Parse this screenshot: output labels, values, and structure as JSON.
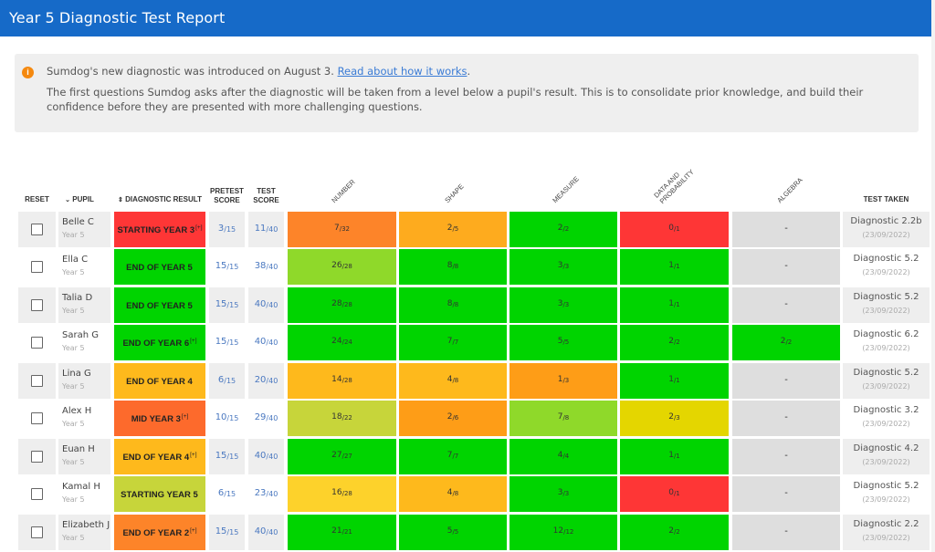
{
  "header": {
    "title": "Year 5 Diagnostic Test Report"
  },
  "notice": {
    "icon": "info-icon",
    "text_before_link": "Sumdog's new diagnostic was introduced on August 3. ",
    "link_text": "Read about how it works",
    "text_after_link": ".",
    "detail": "The first questions Sumdog asks after the diagnostic will be taken from a level below a pupil's result. This is to consolidate prior knowledge, and build their confidence before they are presented with more challenging questions."
  },
  "colors": {
    "header_blue": "#166ac8",
    "red": "#fe3636",
    "orange_red": "#fd6a2c",
    "orange": "#fd8429",
    "dark_orange": "#fe9d17",
    "amber": "#feb91c",
    "yellow": "#fdd22b",
    "olive_yellow": "#e4d600",
    "yellow_green": "#c7d53a",
    "light_green": "#8fd92a",
    "green": "#00d400",
    "grey": "#dedede"
  },
  "table": {
    "headers": {
      "reset": "RESET",
      "pupil": "PUPIL",
      "pupil_sort_icon": "chevron-down-icon",
      "diagnostic": "DIAGNOSTIC RESULT",
      "diagnostic_sort_icon": "sort-icon",
      "pretest_1": "PRETEST",
      "pretest_2": "SCORE",
      "test_1": "TEST",
      "test_2": "SCORE",
      "number": "NUMBER",
      "shape": "SHAPE",
      "measure": "MEASURE",
      "data_1": "DATA AND",
      "data_2": "PROBABILITY",
      "algebra": "ALGEBRA",
      "taken": "TEST TAKEN"
    },
    "rows": [
      {
        "name": "Belle C",
        "year": "Year 5",
        "result": "STARTING YEAR 3",
        "plus": "[+]",
        "result_color": "#fe3636",
        "pre": "3",
        "pre_total": "/15",
        "test": "11",
        "test_total": "/40",
        "number": "7",
        "number_total": "/32",
        "number_color": "#fd8429",
        "shape": "2",
        "shape_total": "/5",
        "shape_color": "#feab1e",
        "measure": "2",
        "measure_total": "/2",
        "measure_color": "#00d400",
        "data": "0",
        "data_total": "/1",
        "data_color": "#fe3636",
        "algebra": "-",
        "algebra_total": "",
        "algebra_color": "#dedede",
        "taken": "Diagnostic 2.2b",
        "date": "(23/09/2022)"
      },
      {
        "name": "Ella C",
        "year": "Year 5",
        "result": "END OF YEAR 5",
        "plus": "",
        "result_color": "#00d400",
        "pre": "15",
        "pre_total": "/15",
        "test": "38",
        "test_total": "/40",
        "number": "26",
        "number_total": "/28",
        "number_color": "#8fd92a",
        "shape": "8",
        "shape_total": "/8",
        "shape_color": "#00d400",
        "measure": "3",
        "measure_total": "/3",
        "measure_color": "#00d400",
        "data": "1",
        "data_total": "/1",
        "data_color": "#00d400",
        "algebra": "-",
        "algebra_total": "",
        "algebra_color": "#dedede",
        "taken": "Diagnostic 5.2",
        "date": "(23/09/2022)"
      },
      {
        "name": "Talia D",
        "year": "Year 5",
        "result": "END OF YEAR 5",
        "plus": "",
        "result_color": "#00d400",
        "pre": "15",
        "pre_total": "/15",
        "test": "40",
        "test_total": "/40",
        "number": "28",
        "number_total": "/28",
        "number_color": "#00d400",
        "shape": "8",
        "shape_total": "/8",
        "shape_color": "#00d400",
        "measure": "3",
        "measure_total": "/3",
        "measure_color": "#00d400",
        "data": "1",
        "data_total": "/1",
        "data_color": "#00d400",
        "algebra": "-",
        "algebra_total": "",
        "algebra_color": "#dedede",
        "taken": "Diagnostic 5.2",
        "date": "(23/09/2022)"
      },
      {
        "name": "Sarah G",
        "year": "Year 5",
        "result": "END OF YEAR 6",
        "plus": "[+]",
        "result_color": "#00d400",
        "pre": "15",
        "pre_total": "/15",
        "test": "40",
        "test_total": "/40",
        "number": "24",
        "number_total": "/24",
        "number_color": "#00d400",
        "shape": "7",
        "shape_total": "/7",
        "shape_color": "#00d400",
        "measure": "5",
        "measure_total": "/5",
        "measure_color": "#00d400",
        "data": "2",
        "data_total": "/2",
        "data_color": "#00d400",
        "algebra": "2",
        "algebra_total": "/2",
        "algebra_color": "#00d400",
        "taken": "Diagnostic 6.2",
        "date": "(23/09/2022)"
      },
      {
        "name": "Lina G",
        "year": "Year 5",
        "result": "END OF YEAR 4",
        "plus": "",
        "result_color": "#feb91c",
        "pre": "6",
        "pre_total": "/15",
        "test": "20",
        "test_total": "/40",
        "number": "14",
        "number_total": "/28",
        "number_color": "#feb91c",
        "shape": "4",
        "shape_total": "/8",
        "shape_color": "#feb91c",
        "measure": "1",
        "measure_total": "/3",
        "measure_color": "#fe9d17",
        "data": "1",
        "data_total": "/1",
        "data_color": "#00d400",
        "algebra": "-",
        "algebra_total": "",
        "algebra_color": "#dedede",
        "taken": "Diagnostic 5.2",
        "date": "(23/09/2022)"
      },
      {
        "name": "Alex H",
        "year": "Year 5",
        "result": "MID YEAR 3",
        "plus": "[+]",
        "result_color": "#fd6a2c",
        "pre": "10",
        "pre_total": "/15",
        "test": "29",
        "test_total": "/40",
        "number": "18",
        "number_total": "/22",
        "number_color": "#c7d53a",
        "shape": "2",
        "shape_total": "/6",
        "shape_color": "#fe9d17",
        "measure": "7",
        "measure_total": "/8",
        "measure_color": "#8fd92a",
        "data": "2",
        "data_total": "/3",
        "data_color": "#e4d600",
        "algebra": "-",
        "algebra_total": "",
        "algebra_color": "#dedede",
        "taken": "Diagnostic 3.2",
        "date": "(23/09/2022)"
      },
      {
        "name": "Euan H",
        "year": "Year 5",
        "result": "END OF YEAR 4",
        "plus": "[+]",
        "result_color": "#feb91c",
        "pre": "15",
        "pre_total": "/15",
        "test": "40",
        "test_total": "/40",
        "number": "27",
        "number_total": "/27",
        "number_color": "#00d400",
        "shape": "7",
        "shape_total": "/7",
        "shape_color": "#00d400",
        "measure": "4",
        "measure_total": "/4",
        "measure_color": "#00d400",
        "data": "1",
        "data_total": "/1",
        "data_color": "#00d400",
        "algebra": "-",
        "algebra_total": "",
        "algebra_color": "#dedede",
        "taken": "Diagnostic 4.2",
        "date": "(23/09/2022)"
      },
      {
        "name": "Kamal H",
        "year": "Year 5",
        "result": "STARTING YEAR 5",
        "plus": "",
        "result_color": "#c7d53a",
        "pre": "6",
        "pre_total": "/15",
        "test": "23",
        "test_total": "/40",
        "number": "16",
        "number_total": "/28",
        "number_color": "#fdd22b",
        "shape": "4",
        "shape_total": "/8",
        "shape_color": "#feb91c",
        "measure": "3",
        "measure_total": "/3",
        "measure_color": "#00d400",
        "data": "0",
        "data_total": "/1",
        "data_color": "#fe3636",
        "algebra": "-",
        "algebra_total": "",
        "algebra_color": "#dedede",
        "taken": "Diagnostic 5.2",
        "date": "(23/09/2022)"
      },
      {
        "name": "Elizabeth J",
        "year": "Year 5",
        "result": "END OF YEAR 2",
        "plus": "[+]",
        "result_color": "#fd8429",
        "pre": "15",
        "pre_total": "/15",
        "test": "40",
        "test_total": "/40",
        "number": "21",
        "number_total": "/21",
        "number_color": "#00d400",
        "shape": "5",
        "shape_total": "/5",
        "shape_color": "#00d400",
        "measure": "12",
        "measure_total": "/12",
        "measure_color": "#00d400",
        "data": "2",
        "data_total": "/2",
        "data_color": "#00d400",
        "algebra": "-",
        "algebra_total": "",
        "algebra_color": "#dedede",
        "taken": "Diagnostic 2.2",
        "date": "(23/09/2022)"
      }
    ]
  }
}
